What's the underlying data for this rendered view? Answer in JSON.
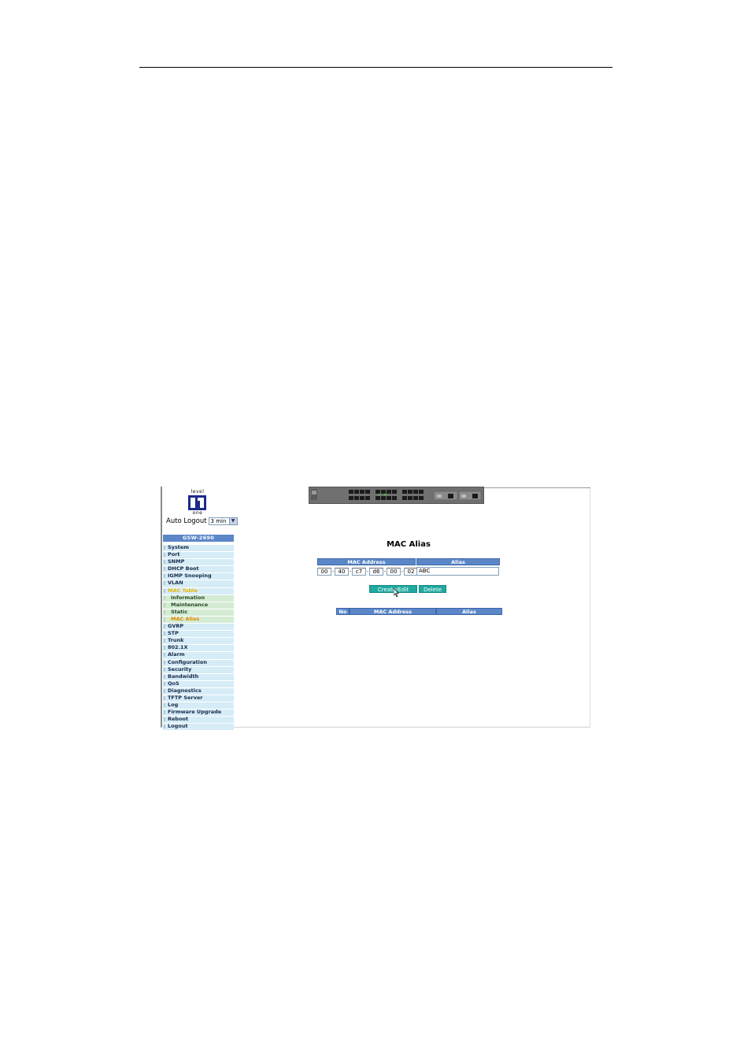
{
  "auto_logout": {
    "label": "Auto Logout",
    "selected": "3 min"
  },
  "logo": {
    "top": "level",
    "bottom": "one"
  },
  "sidebar": {
    "model": "GSW-2690",
    "items": [
      {
        "label": "System"
      },
      {
        "label": "Port"
      },
      {
        "label": "SNMP"
      },
      {
        "label": "DHCP Boot"
      },
      {
        "label": "IGMP Snooping"
      },
      {
        "label": "VLAN"
      },
      {
        "label": "MAC Table"
      },
      {
        "label": "Information"
      },
      {
        "label": "Maintenance"
      },
      {
        "label": "Static"
      },
      {
        "label": "MAC Alias"
      },
      {
        "label": "GVRP"
      },
      {
        "label": "STP"
      },
      {
        "label": "Trunk"
      },
      {
        "label": "802.1X"
      },
      {
        "label": "Alarm"
      },
      {
        "label": "Configuration"
      },
      {
        "label": "Security"
      },
      {
        "label": "Bandwidth"
      },
      {
        "label": "QoS"
      },
      {
        "label": "Diagnostics"
      },
      {
        "label": "TFTP Server"
      },
      {
        "label": "Log"
      },
      {
        "label": "Firmware Upgrade"
      },
      {
        "label": "Reboot"
      },
      {
        "label": "Logout"
      }
    ]
  },
  "main": {
    "title": "MAC Alias",
    "form": {
      "mac_header": "MAC Address",
      "alias_header": "Alias",
      "mac_octets": [
        "00",
        "40",
        "c7",
        "d6",
        "00",
        "02"
      ],
      "separator": "-",
      "alias_value": "ABC"
    },
    "buttons": {
      "create_edit": "Create/Edit",
      "delete": "Delete"
    },
    "list": {
      "col_no": "No",
      "col_mac": "MAC Address",
      "col_alias": "Alias"
    }
  },
  "colors": {
    "header_blue": "#5b87c8",
    "nav_bg": "#d6ecf7",
    "subnav_bg": "#d4ecd4",
    "button_teal": "#1fa9a0"
  }
}
